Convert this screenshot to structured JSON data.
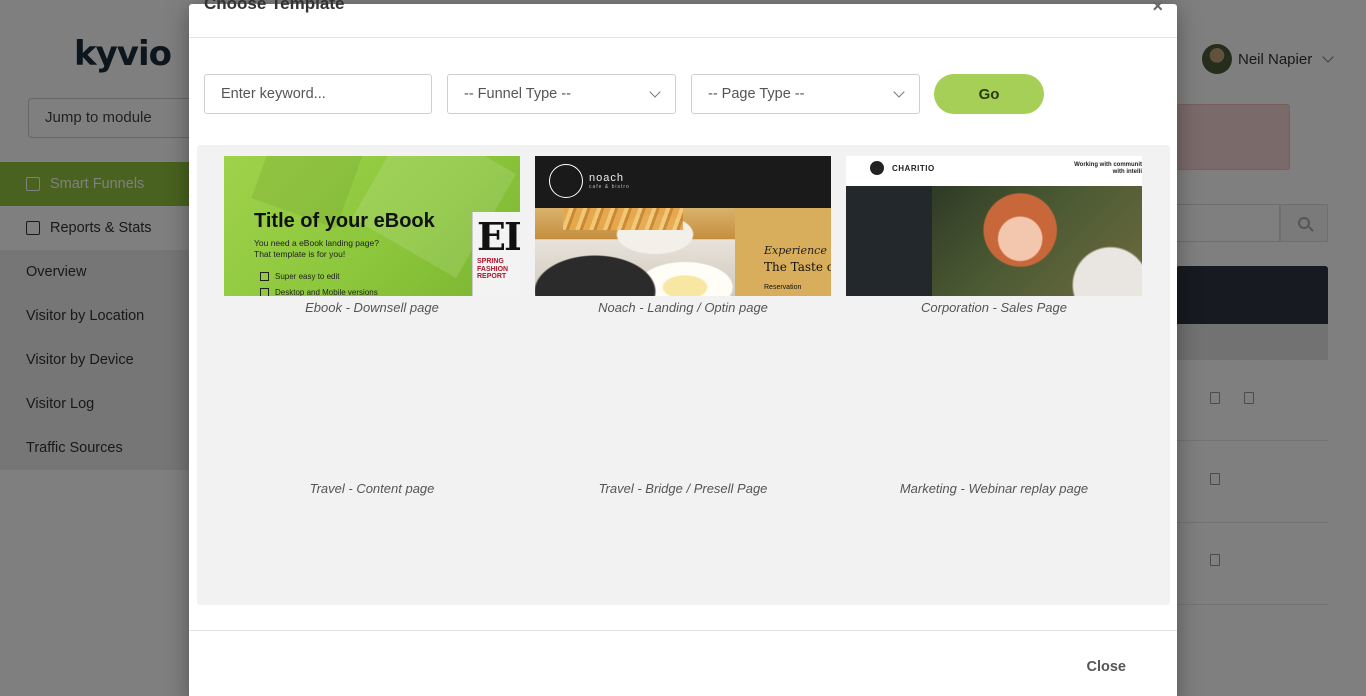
{
  "app": {
    "logo_text": "kyvio",
    "jump_placeholder": "Jump to module",
    "nav": [
      {
        "label": "Smart Funnels"
      },
      {
        "label": "Reports & Stats"
      },
      {
        "label": "Overview"
      },
      {
        "label": "Visitor by Location"
      },
      {
        "label": "Visitor by Device"
      },
      {
        "label": "Visitor Log"
      },
      {
        "label": "Traffic Sources"
      }
    ],
    "user_name": "Neil Napier"
  },
  "modal": {
    "title": "Choose Template",
    "close_x": "×",
    "filters": {
      "keyword_placeholder": "Enter keyword...",
      "funnel_type": "-- Funnel Type --",
      "page_type": "-- Page Type --",
      "go_label": "Go"
    },
    "templates": [
      {
        "label": "Ebook - Downsell page"
      },
      {
        "label": "Noach - Landing / Optin page"
      },
      {
        "label": "Corporation - Sales Page"
      },
      {
        "label": "Travel - Content page"
      },
      {
        "label": "Travel - Bridge / Presell Page"
      },
      {
        "label": "Marketing - Webinar replay page"
      }
    ],
    "ebook_thumb": {
      "heading": "Title of your eBook",
      "line1": "You need a eBook landing page?",
      "line2": "That template is for you!",
      "check1": "Super easy to edit",
      "check2": "Desktop and Mobile versions",
      "mag_title": "EL",
      "mag_report": "SPRING\nFASHION\nREPORT"
    },
    "noach_thumb": {
      "brand": "noach",
      "brand_sub": "cafe & bistro",
      "experience": "Experience",
      "taste": "The Taste of",
      "reservation": "Reservation"
    },
    "chariti_thumb": {
      "brand": "CHARITIO",
      "tagline": "Working with communit\nwith intelli"
    },
    "close_label": "Close"
  }
}
